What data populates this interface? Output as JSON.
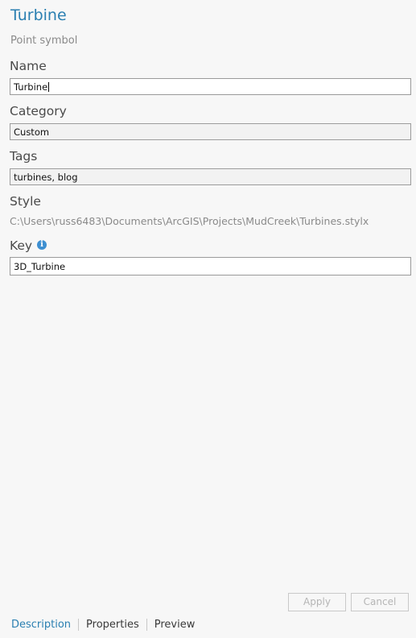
{
  "header": {
    "title": "Turbine",
    "subtitle": "Point symbol"
  },
  "form": {
    "name_label": "Name",
    "name_value": "Turbine",
    "category_label": "Category",
    "category_value": "Custom",
    "tags_label": "Tags",
    "tags_value": "turbines, blog",
    "style_label": "Style",
    "style_path": "C:\\Users\\russ6483\\Documents\\ArcGIS\\Projects\\MudCreek\\Turbines.stylx",
    "key_label": "Key",
    "key_info_glyph": "i",
    "key_value": "3D_Turbine"
  },
  "buttons": {
    "apply_label": "Apply",
    "cancel_label": "Cancel"
  },
  "tabs": [
    {
      "label": "Description",
      "active": true
    },
    {
      "label": "Properties",
      "active": false
    },
    {
      "label": "Preview",
      "active": false
    }
  ],
  "colors": {
    "accent": "#2a7fb1",
    "info_icon": "#3d8fd1"
  }
}
